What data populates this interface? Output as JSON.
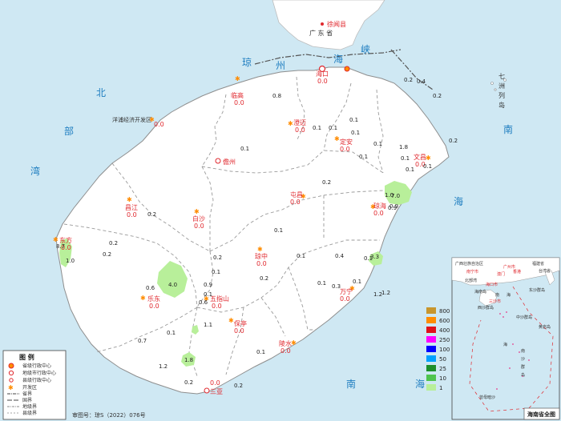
{
  "colors": {
    "sea": "#cfe8f3",
    "land": "#ffffff",
    "border": "#9a9a9a",
    "label_red": "#e0282e",
    "value_red": "#e0282e",
    "green_light": "#b8ef9a",
    "green_mid": "#4fc44f",
    "title_blue": "#1f7ec0"
  },
  "sea_labels": [
    {
      "text": "北"
    },
    {
      "text": "部"
    },
    {
      "text": "湾"
    },
    {
      "text": "琼"
    },
    {
      "text": "州"
    },
    {
      "text": "海"
    },
    {
      "text": "峡"
    },
    {
      "text": "南"
    },
    {
      "text": "海"
    },
    {
      "text": "南"
    },
    {
      "text": "海"
    },
    {
      "text": "七"
    },
    {
      "text": "洲"
    },
    {
      "text": "列"
    },
    {
      "text": "岛"
    }
  ],
  "mainland": {
    "province": "广 东 省",
    "county": "徐闻县"
  },
  "cities": [
    {
      "name": "海口",
      "value": "0.0"
    },
    {
      "name": "临高",
      "value": "0.0"
    },
    {
      "name": "澄迈",
      "value": "0.0"
    },
    {
      "name": "定安",
      "value": "0.0"
    },
    {
      "name": "文昌",
      "value": "0.0"
    },
    {
      "name": "儋州",
      "value": ""
    },
    {
      "name": "屯昌",
      "value": "0.0"
    },
    {
      "name": "琼海",
      "value": "0.0"
    },
    {
      "name": "昌江",
      "value": "0.0"
    },
    {
      "name": "白沙",
      "value": "0.0"
    },
    {
      "name": "东方",
      "value": "0.0"
    },
    {
      "name": "琼中",
      "value": "0.0"
    },
    {
      "name": "乐东",
      "value": "0.0"
    },
    {
      "name": "五指山",
      "value": "0.0"
    },
    {
      "name": "万宁",
      "value": "0.0"
    },
    {
      "name": "保亭",
      "value": "0.0"
    },
    {
      "name": "陵水",
      "value": "0.0"
    },
    {
      "name": "三亚",
      "value": "0.0"
    },
    {
      "name": "洋浦经济开发区",
      "value": "0.0"
    }
  ],
  "station_values": [
    "0.2",
    "0.4",
    "0.2",
    "0.8",
    "0.1",
    "0.1",
    "0.1",
    "0.1",
    "0.1",
    "0.1",
    "1.8",
    "0.1",
    "0.2",
    "0.1",
    "0.1",
    "0.1",
    "0.2",
    "0.2",
    "0.2",
    "0.2",
    "0.1",
    "0.2",
    "0.1",
    "0.1",
    "0.1",
    "0.4",
    "0.9",
    "0.6",
    "0.9",
    "0.1",
    "0.2",
    "0.1",
    "0.3",
    "1.2",
    "1.2",
    "0.7",
    "0.1",
    "1.1",
    "0.1",
    "1.2",
    "0.2",
    "0.2",
    "1.0",
    "8.7",
    "0.1",
    "0.6",
    "1.0",
    "0.9"
  ],
  "precip_patches": [
    {
      "label": "7.0"
    },
    {
      "label": "3.3"
    },
    {
      "label": "4.0"
    },
    {
      "label": "1.8"
    },
    {
      "label": "1.0"
    }
  ],
  "legend_scale": {
    "thresholds": [
      "800",
      "600",
      "400",
      "250",
      "100",
      "50",
      "25",
      "10",
      "1"
    ],
    "colors": [
      "#c8962d",
      "#ff8c00",
      "#e0101a",
      "#ff00ff",
      "#0000ff",
      "#00a0ff",
      "#1c8f2b",
      "#4fc44f",
      "#b8ef9a"
    ]
  },
  "legend": {
    "title": "图  例",
    "items": [
      "省级行政中心",
      "地级市行政中心",
      "县级行政中心",
      "开发区",
      "省界",
      "国界",
      "地级界",
      "县级界"
    ]
  },
  "review_number": "审图号：琼S（2022）076号",
  "inset": {
    "title": "海南省全图",
    "labels": [
      "广西壮族自治区",
      "广州市",
      "福建省",
      "香港",
      "南宁市",
      "海口市",
      "澳门",
      "台湾省",
      "东沙群岛",
      "西沙群岛",
      "南",
      "海",
      "中沙群岛",
      "南",
      "沙",
      "群",
      "岛",
      "海",
      "黄岩岛",
      "曾母暗沙",
      "海南岛",
      "三沙市",
      "北部湾"
    ]
  }
}
